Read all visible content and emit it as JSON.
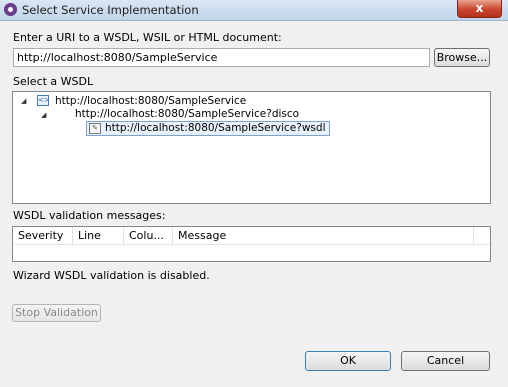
{
  "window": {
    "title": "Select Service Implementation",
    "close_label": "x"
  },
  "uri_section": {
    "label": "Enter a URI to a WSDL, WSIL or HTML document:",
    "value": "http://localhost:8080/SampleService",
    "browse_label": "Browse..."
  },
  "wsdl_section": {
    "label": "Select a WSDL",
    "tree": [
      {
        "label": "http://localhost:8080/SampleService",
        "icon": "wsdl-service-icon"
      },
      {
        "label": "http://localhost:8080/SampleService?disco",
        "icon": "none"
      },
      {
        "label": "http://localhost:8080/SampleService?wsdl",
        "icon": "wsdl-file-icon",
        "selected": true
      }
    ]
  },
  "validation": {
    "label": "WSDL validation messages:",
    "columns": [
      "Severity",
      "Line",
      "Colu...",
      "Message"
    ],
    "status": "Wizard WSDL validation is disabled.",
    "stop_label": "Stop Validation"
  },
  "footer": {
    "ok_label": "OK",
    "cancel_label": "Cancel"
  }
}
